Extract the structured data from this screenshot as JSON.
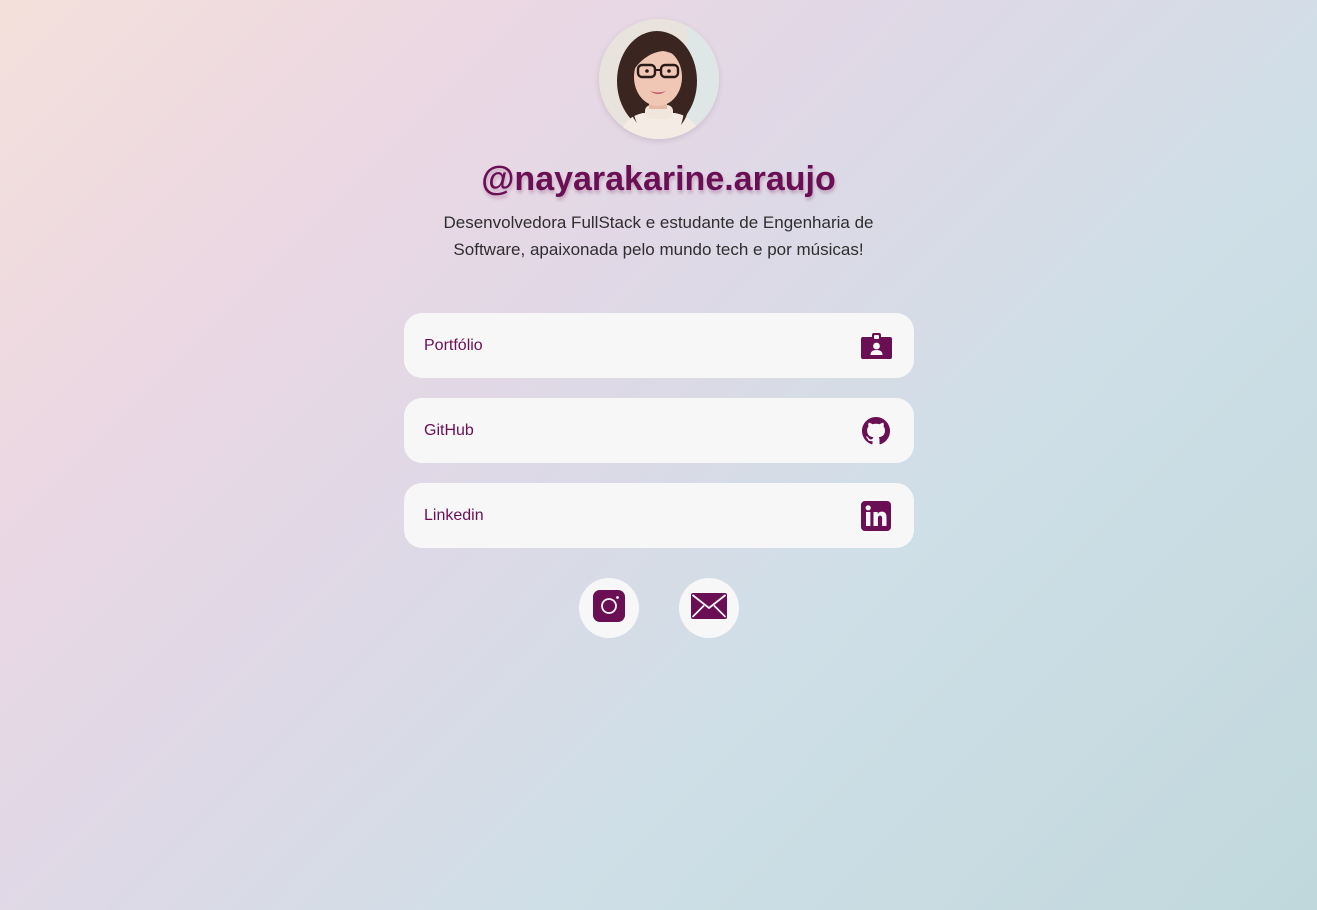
{
  "profile": {
    "username": "@nayarakarine.araujo",
    "bio": "Desenvolvedora FullStack e estudante de Engenharia de Software, apaixonada pelo mundo tech e por músicas!",
    "avatar_alt": "Foto de perfil"
  },
  "links": [
    {
      "label": "Portfólio",
      "icon": "id-badge-icon"
    },
    {
      "label": "GitHub",
      "icon": "github-icon"
    },
    {
      "label": "Linkedin",
      "icon": "linkedin-icon"
    }
  ],
  "socials": [
    {
      "icon": "instagram-icon"
    },
    {
      "icon": "mail-icon"
    }
  ],
  "colors": {
    "accent": "#6b0f55",
    "card": "#f7f7f8",
    "text": "#2e2e2e"
  }
}
